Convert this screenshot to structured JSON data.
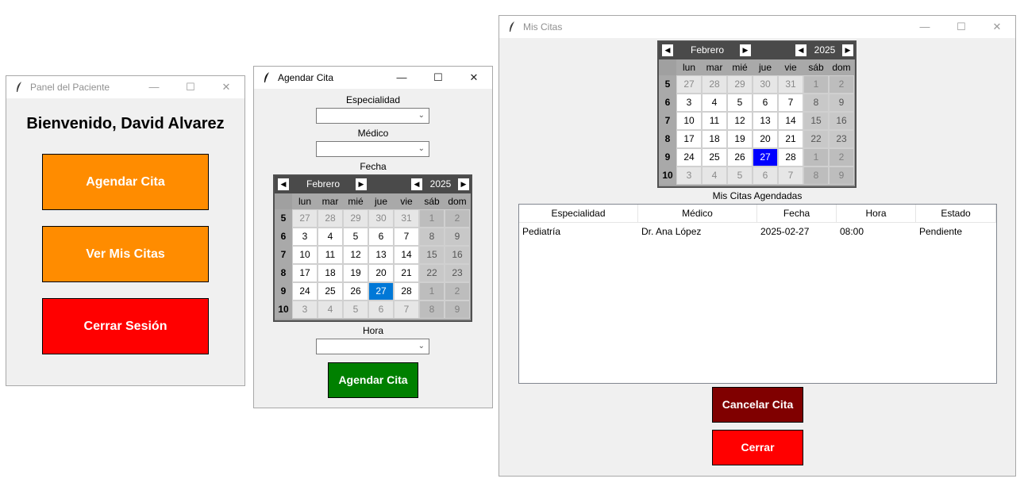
{
  "colors": {
    "orange": "#ff8c00",
    "red": "#ff0000",
    "green": "#008000",
    "dark_red": "#800000",
    "selected_blue_agendar": "#0078d7",
    "selected_blue_citas": "#0000ff"
  },
  "panel": {
    "title": "Panel del Paciente",
    "welcome": "Bienvenido, David Alvarez",
    "btn_agendar": "Agendar Cita",
    "btn_ver": "Ver Mis Citas",
    "btn_cerrar": "Cerrar Sesión"
  },
  "agendar": {
    "title": "Agendar Cita",
    "especialidad_label": "Especialidad",
    "especialidad_value": "",
    "medico_label": "Médico",
    "medico_value": "",
    "fecha_label": "Fecha",
    "hora_label": "Hora",
    "hora_value": "",
    "submit": "Agendar Cita"
  },
  "citas": {
    "title": "Mis Citas",
    "section_label": "Mis Citas Agendadas",
    "columns": [
      "Especialidad",
      "Médico",
      "Fecha",
      "Hora",
      "Estado"
    ],
    "rows": [
      [
        "Pediatría",
        "Dr. Ana López",
        "2025-02-27",
        "08:00",
        "Pendiente"
      ]
    ],
    "btn_cancelar": "Cancelar Cita",
    "btn_cerrar": "Cerrar"
  },
  "calendar": {
    "month": "Febrero",
    "year": "2025",
    "weekdays": [
      "lun",
      "mar",
      "mié",
      "jue",
      "vie",
      "sáb",
      "dom"
    ],
    "week_numbers": [
      "5",
      "6",
      "7",
      "8",
      "9",
      "10"
    ],
    "days": [
      [
        "27",
        "28",
        "29",
        "30",
        "31",
        "1",
        "2"
      ],
      [
        "3",
        "4",
        "5",
        "6",
        "7",
        "8",
        "9"
      ],
      [
        "10",
        "11",
        "12",
        "13",
        "14",
        "15",
        "16"
      ],
      [
        "17",
        "18",
        "19",
        "20",
        "21",
        "22",
        "23"
      ],
      [
        "24",
        "25",
        "26",
        "27",
        "28",
        "1",
        "2"
      ],
      [
        "3",
        "4",
        "5",
        "6",
        "7",
        "8",
        "9"
      ]
    ],
    "selected_day": "27"
  },
  "window_controls": {
    "minimize": "—",
    "maximize": "☐",
    "close": "✕"
  }
}
